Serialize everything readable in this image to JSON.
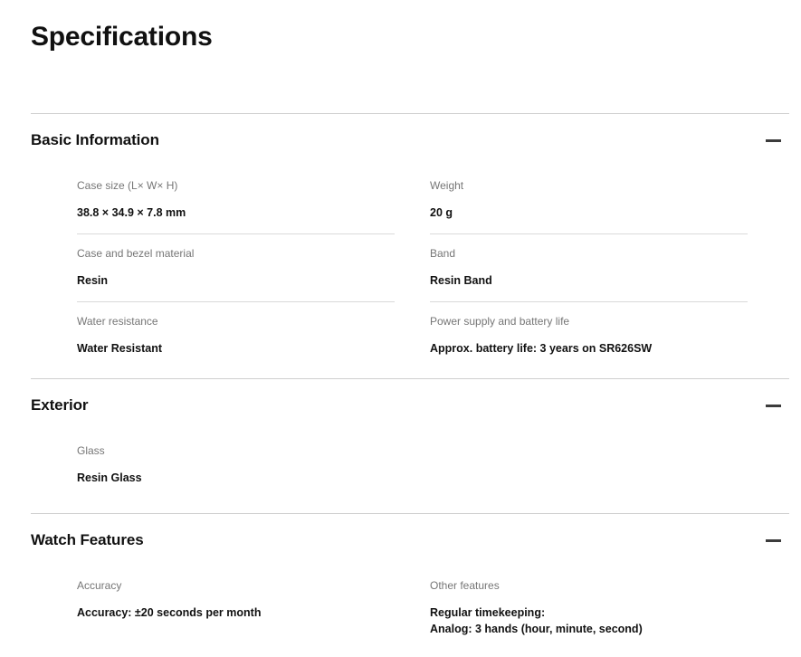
{
  "page": {
    "title": "Specifications"
  },
  "icons": {
    "collapse": "minus-icon"
  },
  "colors": {
    "text": "#111111",
    "label": "#767676",
    "divider": "#cfcfcf",
    "row_divider": "#dadada",
    "icon": "#3c3c3c",
    "background": "#ffffff"
  },
  "sections": [
    {
      "id": "basic-information",
      "title": "Basic Information",
      "expanded": true,
      "columns": [
        {
          "rows": [
            {
              "label": "Case size (L× W× H)",
              "value": "38.8 × 34.9 × 7.8 mm"
            },
            {
              "label": "Case and bezel material",
              "value": "Resin"
            },
            {
              "label": "Water resistance",
              "value": "Water Resistant"
            }
          ]
        },
        {
          "rows": [
            {
              "label": "Weight",
              "value": "20 g"
            },
            {
              "label": "Band",
              "value": "Resin Band"
            },
            {
              "label": "Power supply and battery life",
              "value": "Approx. battery life: 3 years on SR626SW"
            }
          ]
        }
      ]
    },
    {
      "id": "exterior",
      "title": "Exterior",
      "expanded": true,
      "columns": [
        {
          "rows": [
            {
              "label": "Glass",
              "value": "Resin Glass"
            }
          ]
        },
        {
          "rows": []
        }
      ]
    },
    {
      "id": "watch-features",
      "title": "Watch Features",
      "expanded": true,
      "columns": [
        {
          "rows": [
            {
              "label": "Accuracy",
              "value": "Accuracy: ±20 seconds per month"
            }
          ]
        },
        {
          "rows": [
            {
              "label": "Other features",
              "value": "Regular timekeeping:\nAnalog: 3 hands (hour, minute, second)"
            }
          ]
        }
      ]
    }
  ]
}
